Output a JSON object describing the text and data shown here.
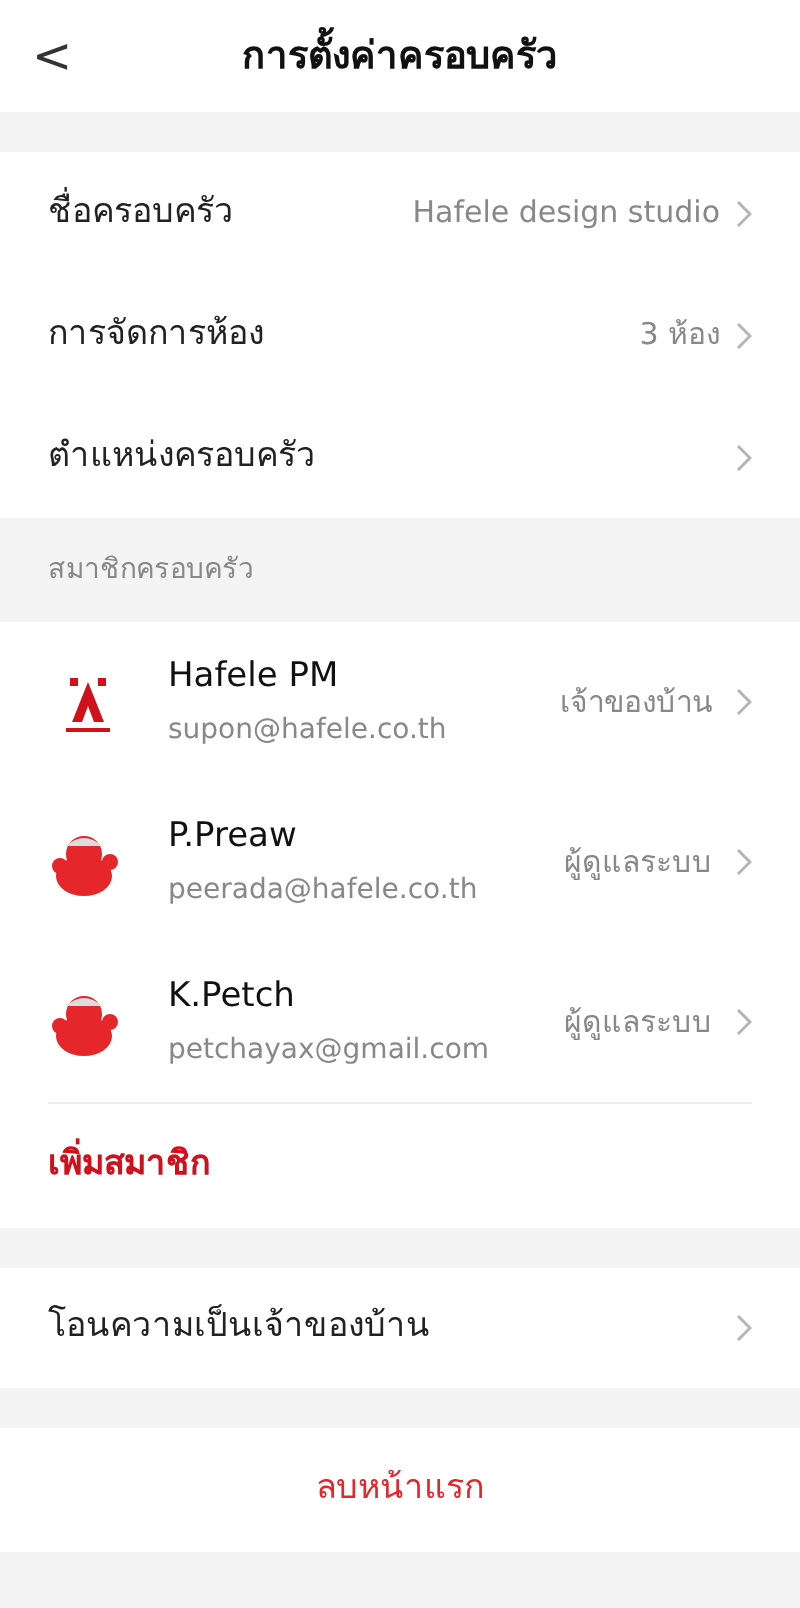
{
  "header": {
    "back": "<",
    "title": "การตั้งค่าครอบครัว"
  },
  "settings": [
    {
      "label": "ชื่อครอบครัว",
      "value": "Hafele design studio"
    },
    {
      "label": "การจัดการห้อง",
      "value": "3 ห้อง"
    },
    {
      "label": "ตำแหน่งครอบครัว"
    }
  ],
  "members_section": {
    "title": "สมาชิกครอบครัว",
    "members": [
      {
        "name": "Hafele PM",
        "email": "supon@hafele.co.th",
        "role": "เจ้าของบ้าน",
        "kind": "logo"
      },
      {
        "name": "P.Preaw",
        "email": "peerada@hafele.co.th",
        "role": "ผู้ดูแลระบบ",
        "kind": "character"
      },
      {
        "name": "K.Petch",
        "email": "petchayax@gmail.com",
        "role": "ผู้ดูแลระบบ",
        "kind": "character"
      }
    ],
    "add": "เพิ่มสมาชิก"
  },
  "transfer": {
    "label": "โอนความเป็นเจ้าของบ้าน"
  },
  "delete": "ลบหน้าแรก"
}
